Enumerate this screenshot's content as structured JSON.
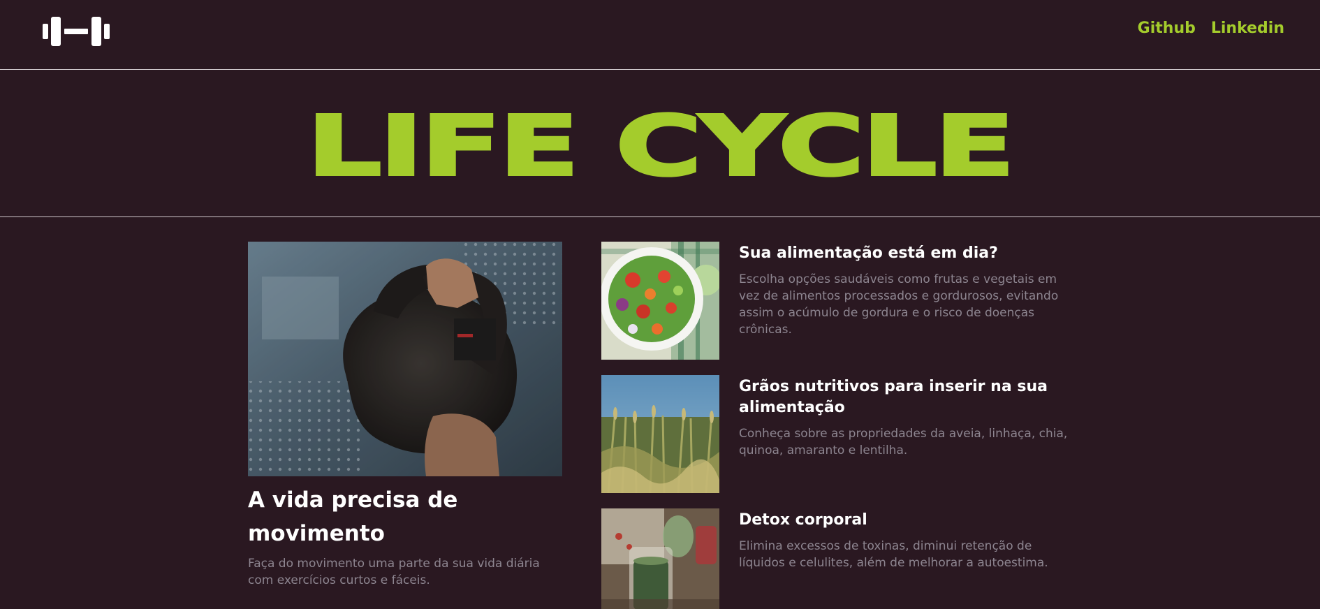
{
  "header": {
    "logo_icon": "dumbbell-icon",
    "nav": [
      {
        "label": "Github"
      },
      {
        "label": "Linkedin"
      }
    ]
  },
  "hero": {
    "title": "LIFE CYCLE"
  },
  "feature": {
    "image_icon": "kettlebell-photo",
    "title": "A vida precisa de movimento",
    "text": "Faça do movimento uma parte da sua vida diária com exercícios curtos e fáceis."
  },
  "articles": [
    {
      "image_icon": "salad-photo",
      "title": "Sua alimentação está em dia?",
      "text": "Escolha opções saudáveis como frutas e vegetais em vez de alimentos processados e gordurosos, evitando assim o acúmulo de gordura e o risco de doenças crônicas."
    },
    {
      "image_icon": "grain-field-photo",
      "title": "Grãos nutritivos para inserir na sua alimentação",
      "text": "Conheça sobre as propriedades da aveia, linhaça, chia, quinoa, amaranto e lentilha."
    },
    {
      "image_icon": "green-juice-photo",
      "title": "Detox corporal",
      "text": "Elimina excessos de toxinas, diminui retenção de líquidos e celulites, além de melhorar a autoestima."
    }
  ],
  "colors": {
    "background": "#2a1821",
    "accent": "#a4cc2c",
    "muted_text": "#8d8590",
    "divider": "#cfc8cc"
  }
}
